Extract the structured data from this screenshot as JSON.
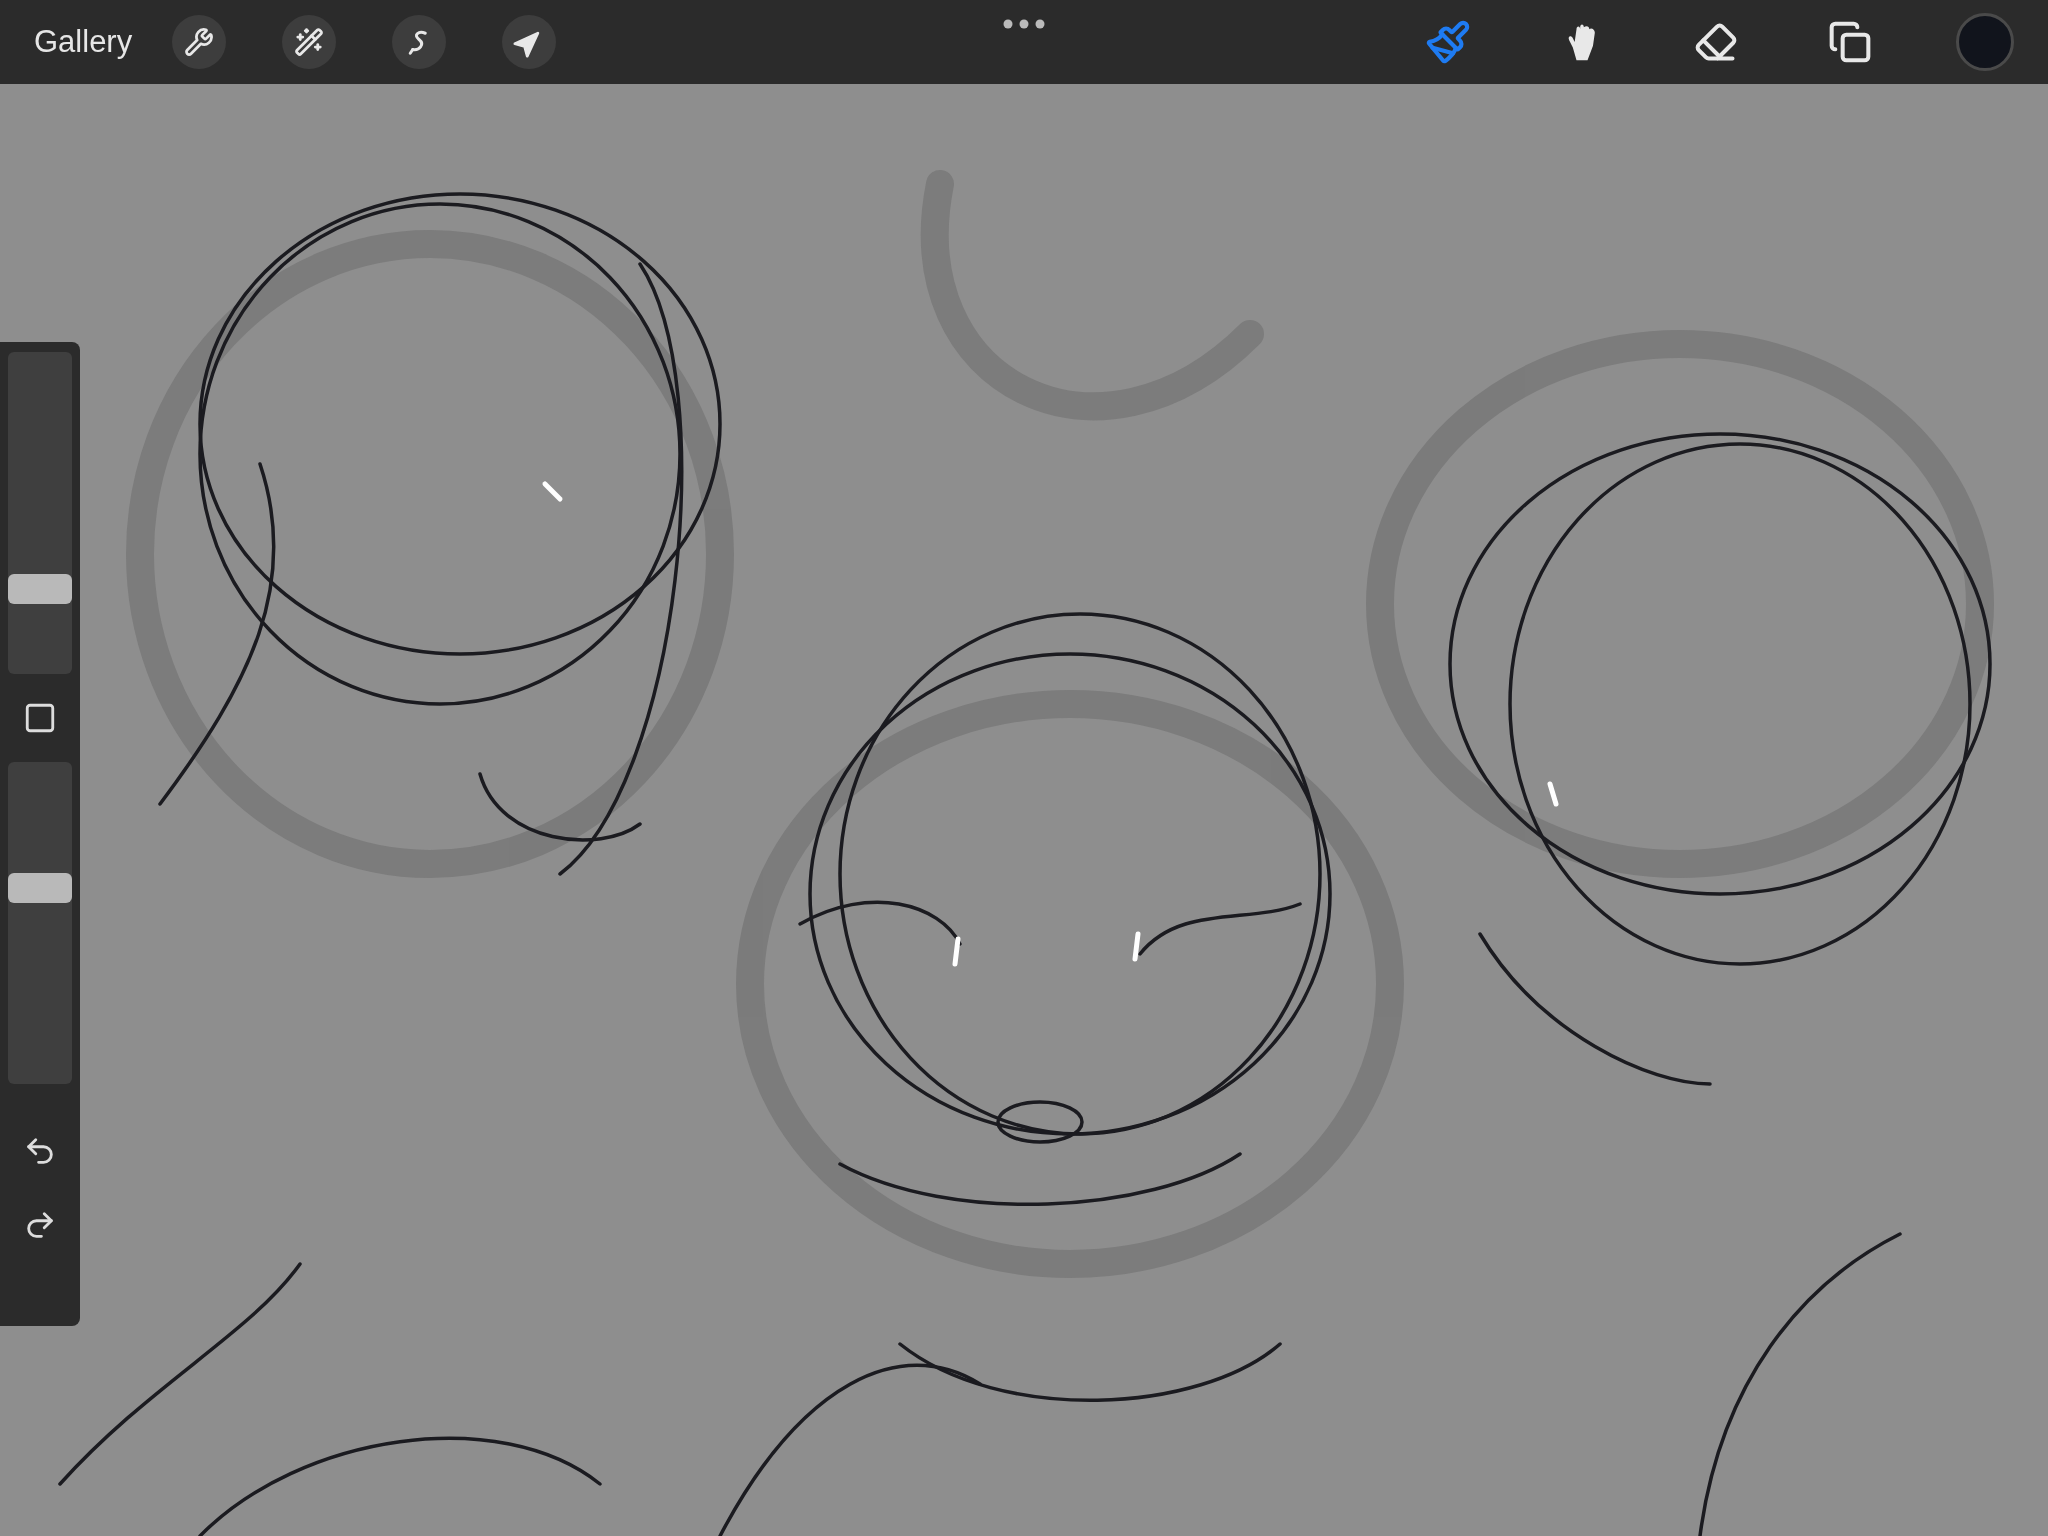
{
  "toolbar": {
    "gallery": "Gallery",
    "left_tools": [
      {
        "kind": "wrench",
        "selected": false
      },
      {
        "kind": "wand",
        "selected": false
      },
      {
        "kind": "selection",
        "selected": false
      },
      {
        "kind": "transform",
        "selected": false
      }
    ],
    "right_tools": [
      {
        "kind": "brush",
        "selected": true
      },
      {
        "kind": "smudge",
        "selected": false
      },
      {
        "kind": "eraser",
        "selected": false
      },
      {
        "kind": "layers",
        "selected": false
      }
    ],
    "color": "#11141c"
  },
  "sidebar": {
    "size": {
      "level": 0.24
    },
    "opacity": {
      "level": 0.62
    }
  }
}
